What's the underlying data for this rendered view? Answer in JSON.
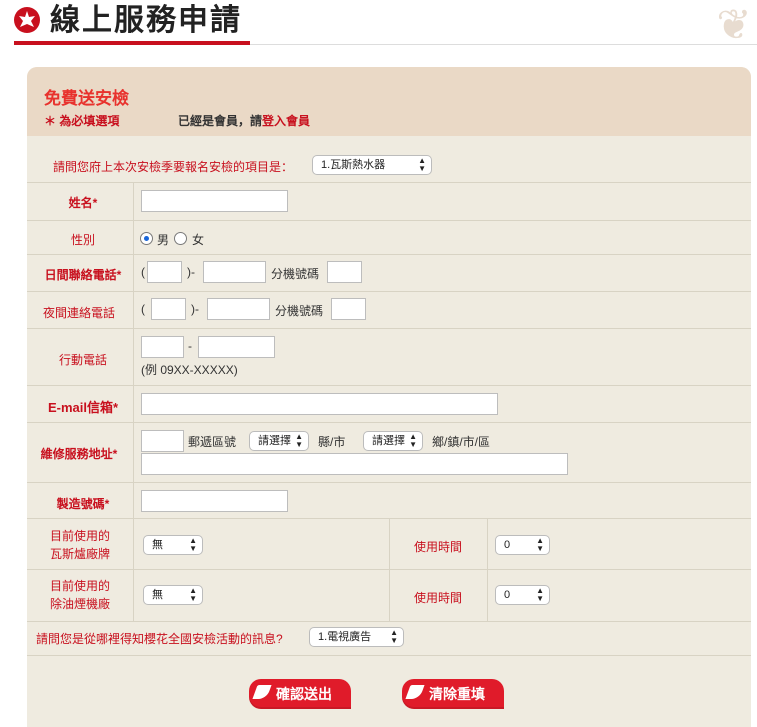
{
  "header": {
    "title": "線上服務申請"
  },
  "form": {
    "title": "免費送安檢",
    "required_note": "＊ 為必填選項",
    "member_prefix": "已經是會員，請",
    "member_link": "登入會員",
    "item_question": "請問您府上本次安檢季要報名安檢的項目是：",
    "item_value": "1.瓦斯熱水器",
    "name_label": "姓名*",
    "gender_label": "性別",
    "gender_male": "男",
    "gender_female": "女",
    "day_phone_label": "日間聯絡電話*",
    "night_phone_label": "夜間連絡電話",
    "paren_open": "(",
    "paren_close": ")-",
    "ext_label": "分機號碼",
    "mobile_label": "行動電話",
    "mobile_dash": "-",
    "mobile_example": "(例 09XX-XXXXX)",
    "email_label": "E-mail信箱*",
    "address_label": "維修服務地址*",
    "zip_label": "郵遞區號",
    "county_placeholder": "請選擇",
    "county_suffix": "縣/市",
    "town_placeholder": "請選擇",
    "town_suffix": "鄉/鎮/市/區",
    "serial_label": "製造號碼*",
    "gas_brand_label": "目前使用的瓦斯爐廠牌",
    "gas_brand_value": "無",
    "gas_time_label": "使用時間",
    "gas_time_value": "0",
    "hood_brand_label": "目前使用的除油煙機廠",
    "hood_brand_value": "無",
    "hood_time_label": "使用時間",
    "hood_time_value": "0",
    "source_question": "請問您是從哪裡得知櫻花全國安檢活動的訊息?",
    "source_value": "1.電視廣告",
    "submit_label": "確認送出",
    "reset_label": "清除重填"
  },
  "colors": {
    "brand_red": "#c8101e",
    "panel_bg": "#efebe0",
    "panel_head": "#ead9c6"
  }
}
